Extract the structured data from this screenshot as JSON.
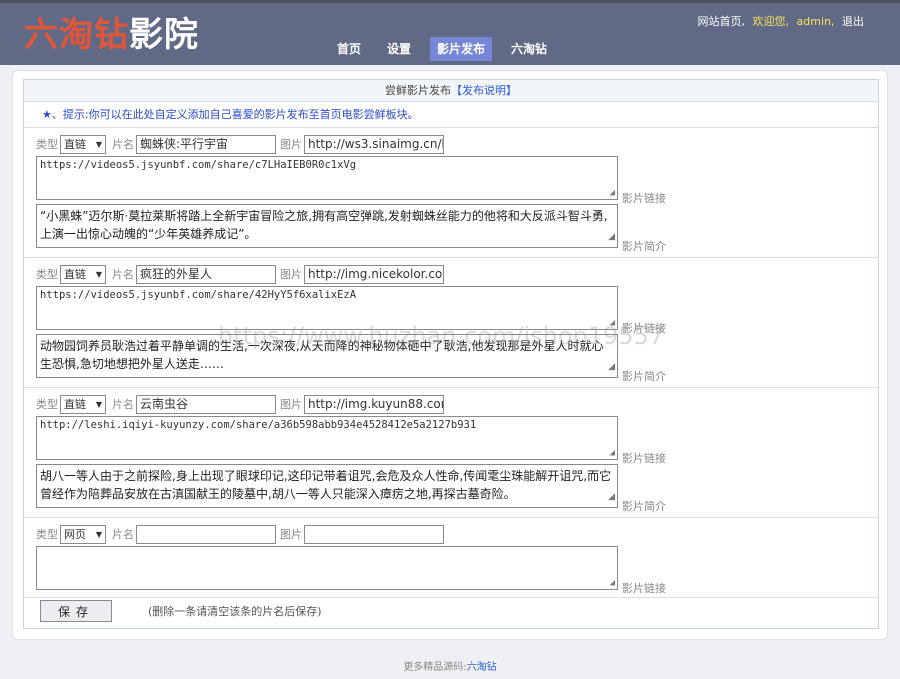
{
  "logo": {
    "part1": "六淘钻",
    "part2": "影院"
  },
  "nav": [
    "首页",
    "设置",
    "影片发布",
    "六淘钻"
  ],
  "toplinks": {
    "home": "网站首页,",
    "welcome": "欢迎您,",
    "user": "admin,",
    "logout": "退出"
  },
  "panel": {
    "title": "尝鲜影片发布",
    "help_link": "【发布说明】"
  },
  "tip": "★、提示:你可以在此处自定义添加自己喜爱的影片发布至首页电影尝鲜板块。",
  "labels": {
    "type": "类型",
    "name": "片名",
    "pic": "图片",
    "link": "影片链接",
    "intro": "影片简介"
  },
  "entries": [
    {
      "type": "直链",
      "name": "蜘蛛侠:平行宇宙",
      "pic": "http://ws3.sinaimg.cn/l",
      "link": "https://videos5.jsyunbf.com/share/c7LHaIEB0R0c1xVg",
      "intro": "“小黑蛛”迈尔斯·莫拉莱斯将踏上全新宇宙冒险之旅,拥有高空弹跳,发射蜘蛛丝能力的他将和大反派斗智斗勇,上演一出惊心动魄的“少年英雄养成记”。"
    },
    {
      "type": "直链",
      "name": "疯狂的外星人",
      "pic": "http://img.nicekolor.co",
      "link": "https://videos5.jsyunbf.com/share/42HyY5f6xalixEzA",
      "intro": "动物园饲养员耿浩过着平静单调的生活,一次深夜,从天而降的神秘物体砸中了耿浩,他发现那是外星人时就心生恐惧,急切地想把外星人送走……"
    },
    {
      "type": "直链",
      "name": "云南虫谷",
      "pic": "http://img.kuyun88.cor",
      "link": "http://leshi.iqiyi-kuyunzy.com/share/a36b598abb934e4528412e5a2127b931",
      "intro": "胡八一等人由于之前探险,身上出现了眼球印记,这印记带着诅咒,会危及众人性命,传闻雮尘珠能解开诅咒,而它曾经作为陪葬品安放在古滇国献王的陵墓中,胡八一等人只能深入瘴疠之地,再探古墓奇险。"
    }
  ],
  "new_entry": {
    "type": "网页",
    "name": "",
    "pic": "",
    "link": ""
  },
  "save_button": "保存",
  "save_note": "(删除一条请清空该条的片名后保存)",
  "footer": {
    "text": "更多精品源码:",
    "link": "六淘钻"
  },
  "watermark": "https://www.huzhan.com/ishop19557"
}
